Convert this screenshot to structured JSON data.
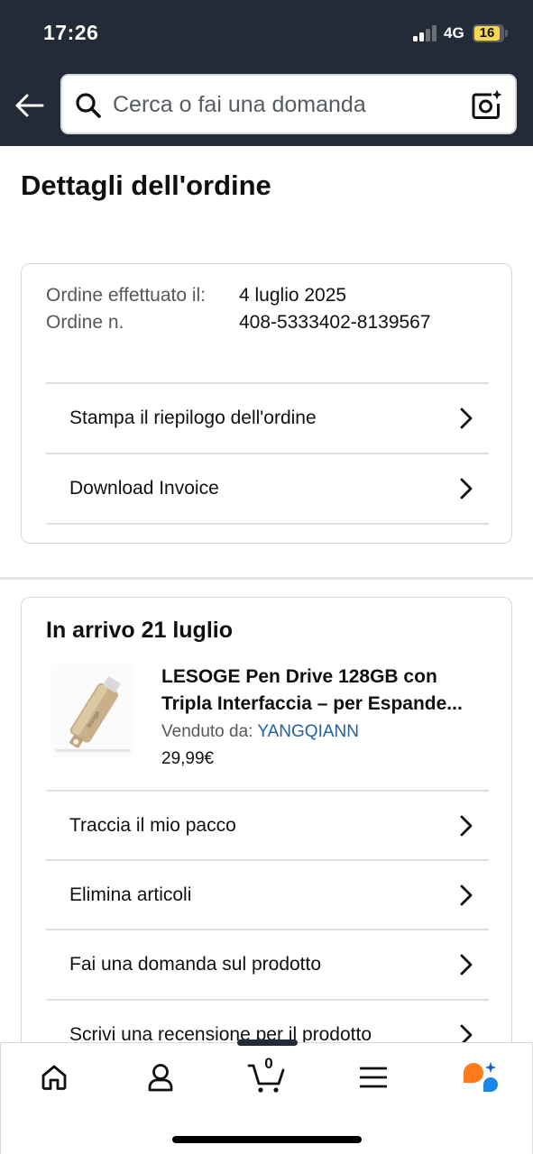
{
  "status_bar": {
    "time": "17:26",
    "network": "4G",
    "battery": "16"
  },
  "search": {
    "placeholder": "Cerca o fai una domanda"
  },
  "page": {
    "title": "Dettagli dell'ordine"
  },
  "order_info": {
    "placed_label": "Ordine effettuato il:",
    "number_label": "Ordine n.",
    "placed_value": "4 luglio 2025",
    "number_value": "408-5333402-8139567"
  },
  "order_actions": [
    {
      "label": "Stampa il riepilogo dell'ordine"
    },
    {
      "label": "Download Invoice"
    }
  ],
  "shipment": {
    "arrival": "In arrivo 21 luglio",
    "product": {
      "title_line1": "LESOGE Pen Drive 128GB con",
      "title_line2": "Tripla Interfaccia – per Espande...",
      "seller_label": "Venduto da:",
      "seller_name": "YANGQIANN",
      "price": "29,99€",
      "image_icon": "usb-flash-drive-image"
    },
    "actions": [
      {
        "label": "Traccia il mio pacco"
      },
      {
        "label": "Elimina articoli"
      },
      {
        "label": "Fai una domanda sul prodotto"
      },
      {
        "label": "Scrivi una recensione per il prodotto"
      }
    ]
  },
  "bottom_nav": {
    "cart_count": "0",
    "items": [
      "home-icon",
      "account-icon",
      "cart-icon",
      "menu-icon",
      "rufus-assistant-icon"
    ]
  },
  "colors": {
    "header_bg": "#222b37",
    "link": "#2162a1",
    "battery": "#f7d74b",
    "assistant_orange": "#ff7a1a",
    "assistant_blue": "#1a86e8"
  }
}
